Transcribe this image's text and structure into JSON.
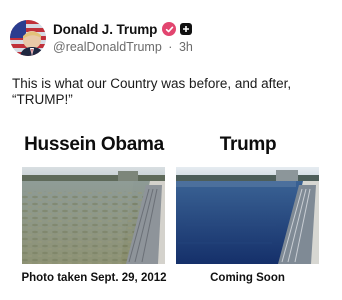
{
  "post": {
    "display_name": "Donald J. Trump",
    "handle": "@realDonaldTrump",
    "separator": "·",
    "timestamp": "3h",
    "text": "This is what our Country was before, and after, “TRUMP!”",
    "badges": [
      "verified-icon",
      "plus-badge-icon"
    ],
    "avatar_icon": "flag-avatar",
    "verified_color": "#e2456f"
  },
  "meme": {
    "left": {
      "title": "Hussein Obama",
      "caption": "Photo taken Sept. 29, 2012",
      "image": "reflecting-pool-murky"
    },
    "right": {
      "title": "Trump",
      "caption": "Coming Soon",
      "image": "reflecting-pool-clean"
    }
  }
}
